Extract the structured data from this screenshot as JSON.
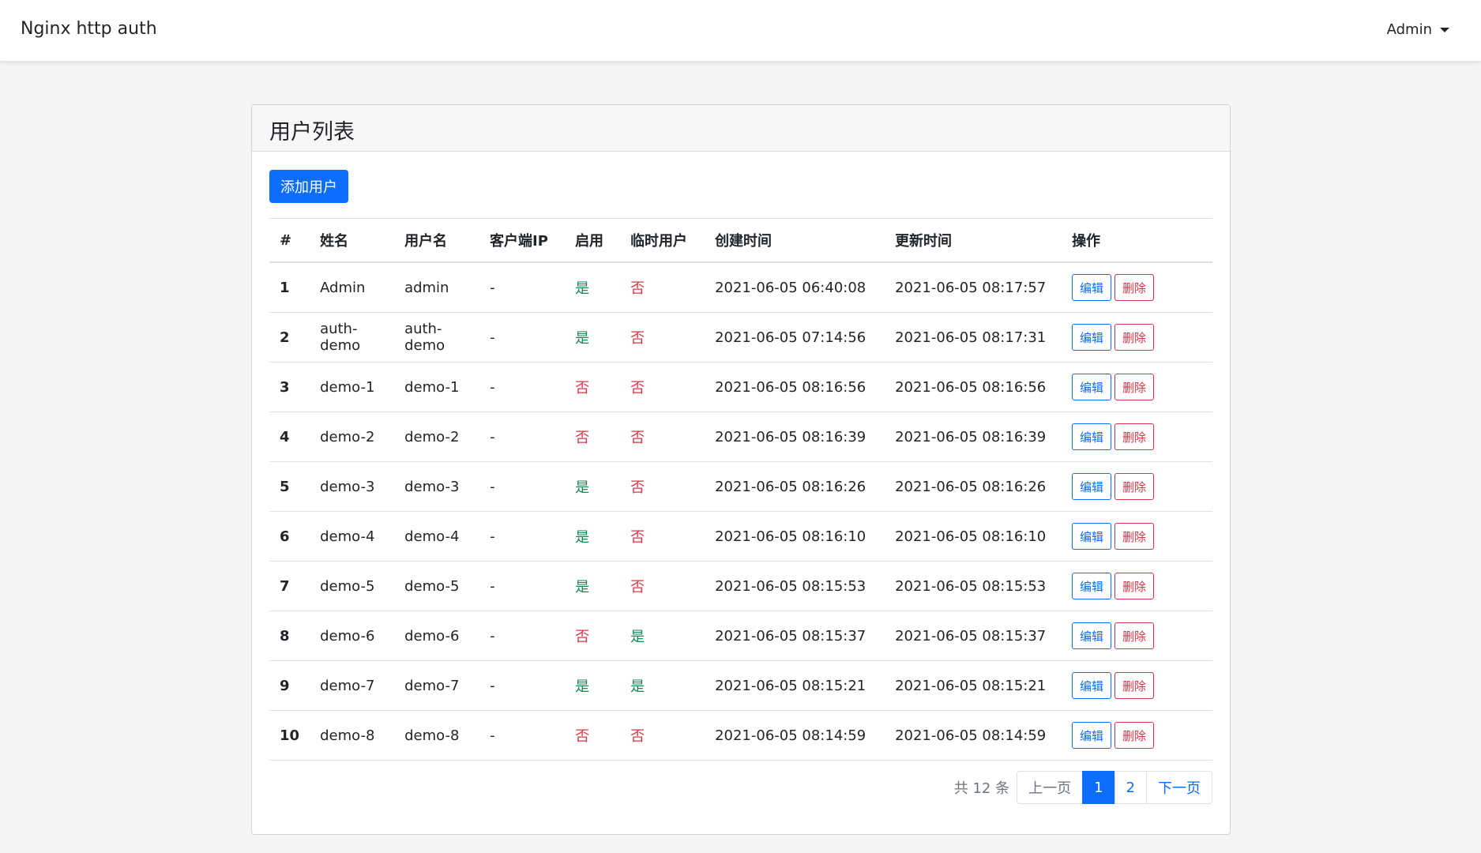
{
  "navbar": {
    "brand": "Nginx http auth",
    "user": "Admin"
  },
  "card": {
    "title": "用户列表",
    "add_button": "添加用户"
  },
  "table": {
    "headers": [
      "#",
      "姓名",
      "用户名",
      "客户端IP",
      "启用",
      "临时用户",
      "创建时间",
      "更新时间",
      "操作"
    ],
    "rows": [
      {
        "idx": "1",
        "name": "Admin",
        "username": "admin",
        "ip": "-",
        "enabled": "是",
        "temp": "否",
        "created": "2021-06-05 06:40:08",
        "updated": "2021-06-05 08:17:57"
      },
      {
        "idx": "2",
        "name": "auth-demo",
        "username": "auth-demo",
        "ip": "-",
        "enabled": "是",
        "temp": "否",
        "created": "2021-06-05 07:14:56",
        "updated": "2021-06-05 08:17:31"
      },
      {
        "idx": "3",
        "name": "demo-1",
        "username": "demo-1",
        "ip": "-",
        "enabled": "否",
        "temp": "否",
        "created": "2021-06-05 08:16:56",
        "updated": "2021-06-05 08:16:56"
      },
      {
        "idx": "4",
        "name": "demo-2",
        "username": "demo-2",
        "ip": "-",
        "enabled": "否",
        "temp": "否",
        "created": "2021-06-05 08:16:39",
        "updated": "2021-06-05 08:16:39"
      },
      {
        "idx": "5",
        "name": "demo-3",
        "username": "demo-3",
        "ip": "-",
        "enabled": "是",
        "temp": "否",
        "created": "2021-06-05 08:16:26",
        "updated": "2021-06-05 08:16:26"
      },
      {
        "idx": "6",
        "name": "demo-4",
        "username": "demo-4",
        "ip": "-",
        "enabled": "是",
        "temp": "否",
        "created": "2021-06-05 08:16:10",
        "updated": "2021-06-05 08:16:10"
      },
      {
        "idx": "7",
        "name": "demo-5",
        "username": "demo-5",
        "ip": "-",
        "enabled": "是",
        "temp": "否",
        "created": "2021-06-05 08:15:53",
        "updated": "2021-06-05 08:15:53"
      },
      {
        "idx": "8",
        "name": "demo-6",
        "username": "demo-6",
        "ip": "-",
        "enabled": "否",
        "temp": "是",
        "created": "2021-06-05 08:15:37",
        "updated": "2021-06-05 08:15:37"
      },
      {
        "idx": "9",
        "name": "demo-7",
        "username": "demo-7",
        "ip": "-",
        "enabled": "是",
        "temp": "是",
        "created": "2021-06-05 08:15:21",
        "updated": "2021-06-05 08:15:21"
      },
      {
        "idx": "10",
        "name": "demo-8",
        "username": "demo-8",
        "ip": "-",
        "enabled": "否",
        "temp": "否",
        "created": "2021-06-05 08:14:59",
        "updated": "2021-06-05 08:14:59"
      }
    ],
    "edit_label": "编辑",
    "delete_label": "删除",
    "yes_value": "是"
  },
  "pagination": {
    "total": "共 12 条",
    "prev": "上一页",
    "pages": [
      "1",
      "2"
    ],
    "current": "1",
    "next": "下一页"
  },
  "colors": {
    "primary": "#0d6efd",
    "danger": "#dc3545",
    "success": "#198754"
  }
}
